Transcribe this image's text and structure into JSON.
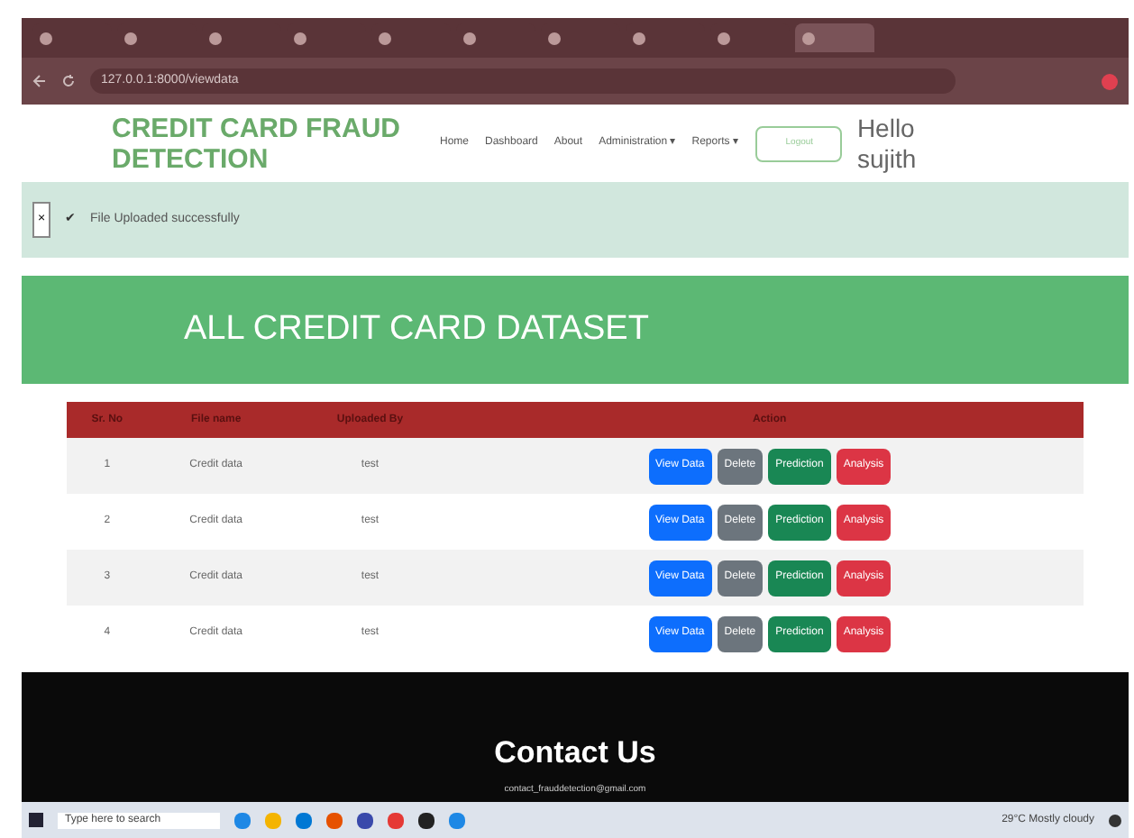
{
  "browser": {
    "tabs": [
      {
        "selected": false
      },
      {
        "selected": false
      },
      {
        "selected": false
      },
      {
        "selected": false
      },
      {
        "selected": false
      },
      {
        "selected": false
      },
      {
        "selected": false
      },
      {
        "selected": false
      },
      {
        "selected": false
      },
      {
        "selected": true
      }
    ],
    "address": "127.0.0.1:8000/viewdata"
  },
  "brand": "CREDIT CARD FRAUD DETECTION",
  "nav": [
    "Home",
    "Dashboard",
    "About",
    "Administration ▾",
    "Reports ▾"
  ],
  "logout": "Logout",
  "greeting": "Hello sujith",
  "alert": {
    "close": "×",
    "icon": "✔",
    "message": "File Uploaded successfully"
  },
  "banner": "ALL CREDIT CARD DATASET",
  "table": {
    "columns": [
      "Sr. No",
      "File name",
      "Uploaded By",
      "Action"
    ],
    "rows": [
      {
        "cells": [
          "1",
          "Credit data",
          "test"
        ],
        "actions": [
          {
            "label": "View Data",
            "kind": "primary"
          },
          {
            "label": "Delete",
            "kind": "secondary"
          },
          {
            "label": "Prediction",
            "kind": "success"
          },
          {
            "label": "Analysis",
            "kind": "danger"
          }
        ]
      },
      {
        "cells": [
          "2",
          "Credit data",
          "test"
        ],
        "actions": [
          {
            "label": "View Data",
            "kind": "primary"
          },
          {
            "label": "Delete",
            "kind": "secondary"
          },
          {
            "label": "Prediction",
            "kind": "success"
          },
          {
            "label": "Analysis",
            "kind": "danger"
          }
        ]
      },
      {
        "cells": [
          "3",
          "Credit data",
          "test"
        ],
        "actions": [
          {
            "label": "View Data",
            "kind": "primary"
          },
          {
            "label": "Delete",
            "kind": "secondary"
          },
          {
            "label": "Prediction",
            "kind": "success"
          },
          {
            "label": "Analysis",
            "kind": "danger"
          }
        ]
      },
      {
        "cells": [
          "4",
          "Credit data",
          "test"
        ],
        "actions": [
          {
            "label": "View Data",
            "kind": "primary"
          },
          {
            "label": "Delete",
            "kind": "secondary"
          },
          {
            "label": "Prediction",
            "kind": "success"
          },
          {
            "label": "Analysis",
            "kind": "danger"
          }
        ]
      }
    ]
  },
  "footer": {
    "title": "Contact Us",
    "email": "contact_frauddetection@gmail.com"
  },
  "taskbar": {
    "search": "Type here to search",
    "weather": "29°C Mostly cloudy"
  }
}
